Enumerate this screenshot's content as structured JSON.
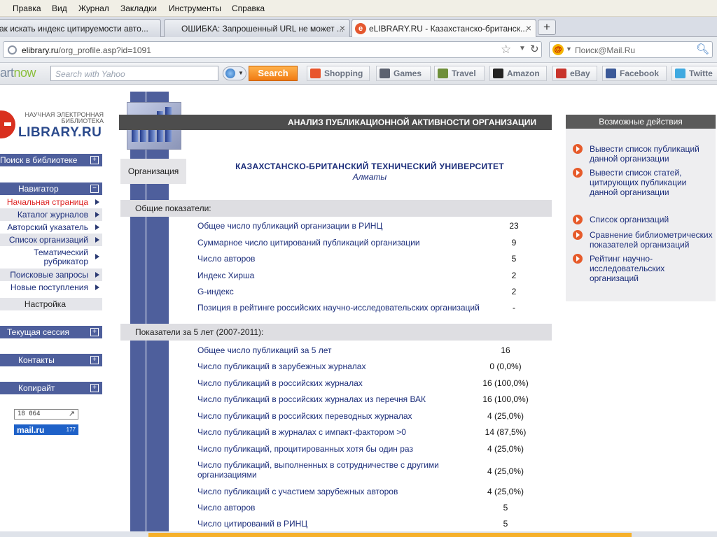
{
  "browser": {
    "menu": [
      "Правка",
      "Вид",
      "Журнал",
      "Закладки",
      "Инструменты",
      "Справка"
    ],
    "tabs": [
      {
        "title": "ак искать индекс цитируемости авто...",
        "active": false
      },
      {
        "title": "ОШИБКА: Запрошенный URL не может ...",
        "active": false
      },
      {
        "title": "eLIBRARY.RU - Казахстанско-британск...",
        "active": true,
        "favicon": "e"
      }
    ],
    "new_tab_label": "+",
    "close_glyph": "×",
    "url_host": "elibrary.ru",
    "url_path": "/org_profile.asp?id=1091",
    "search_placeholder": "Поиск@Mail.Ru",
    "search_engine_icon": "mailru-icon"
  },
  "toolbar": {
    "brand_prefix": "art",
    "brand_suffix": "now",
    "search_placeholder": "Search with Yahoo",
    "search_button": "Search",
    "links": [
      {
        "label": "Shopping",
        "icon": "shopping-icon",
        "color": "#e8552c"
      },
      {
        "label": "Games",
        "icon": "games-icon",
        "color": "#5c6270"
      },
      {
        "label": "Travel",
        "icon": "travel-icon",
        "color": "#6e8f3a"
      },
      {
        "label": "Amazon",
        "icon": "amazon-icon",
        "color": "#222222"
      },
      {
        "label": "eBay",
        "icon": "ebay-icon",
        "color": "#c8342c"
      },
      {
        "label": "Facebook",
        "icon": "facebook-icon",
        "color": "#3b5998"
      },
      {
        "label": "Twitte",
        "icon": "twitter-icon",
        "color": "#3fa9e0"
      }
    ]
  },
  "logo": {
    "line1": "НАУЧНАЯ ЭЛЕКТРОННАЯ",
    "line2": "БИБЛИОТЕКА",
    "name": "LIBRARY.RU"
  },
  "sidebar": {
    "search": "Поиск в библиотеке",
    "navigator": "Навигатор",
    "items": [
      {
        "label": "Начальная страница",
        "active": true
      },
      {
        "label": "Каталог журналов"
      },
      {
        "label": "Авторский указатель"
      },
      {
        "label": "Список организаций"
      },
      {
        "label": "Тематический рубрикатор"
      },
      {
        "label": "Поисковые запросы"
      },
      {
        "label": "Новые поступления"
      }
    ],
    "settings": "Настройка",
    "session": "Текущая сессия",
    "contacts": "Контакты",
    "copyright": "Копирайт",
    "counter_value": "18 064",
    "mail_counter_label": "mail.ru",
    "mail_counter_value": "177"
  },
  "main": {
    "title": "АНАЛИЗ ПУБЛИКАЦИОННОЙ АКТИВНОСТИ ОРГАНИЗАЦИИ",
    "org_label": "Организация",
    "org_name": "КАЗАХСТАНСКО-БРИТАНСКИЙ ТЕХНИЧЕСКИЙ УНИВЕРСИТЕТ",
    "org_city": "Алматы",
    "general_title": "Общие показатели:",
    "general": [
      {
        "label": "Общее число публикаций организации в РИНЦ",
        "value": "23"
      },
      {
        "label": "Суммарное число цитирований публикаций организации",
        "value": "9"
      },
      {
        "label": "Число авторов",
        "value": "5"
      },
      {
        "label": "Индекс Хирша",
        "value": "2"
      },
      {
        "label": "G-индекс",
        "value": "2"
      },
      {
        "label": "Позиция в рейтинге российских научно-исследовательских организаций",
        "value": "-"
      }
    ],
    "period_title": "Показатели за 5 лет (2007-2011):",
    "period": [
      {
        "label": "Общее число публикаций за 5 лет",
        "value": "16"
      },
      {
        "label": "Число публикаций в зарубежных журналах",
        "value": "0 (0,0%)"
      },
      {
        "label": "Число публикаций в российских журналах",
        "value": "16 (100,0%)"
      },
      {
        "label": "Число публикаций в российских журналах из перечня ВАК",
        "value": "16 (100,0%)"
      },
      {
        "label": "Число публикаций в российских переводных журналах",
        "value": "4 (25,0%)"
      },
      {
        "label": "Число публикаций в журналах с импакт-фактором >0",
        "value": "14 (87,5%)"
      },
      {
        "label": "Число публикаций, процитированных хотя бы один раз",
        "value": "4 (25,0%)"
      },
      {
        "label": "Число публикаций, выполненных в сотрудничестве с другими организациями",
        "value": "4 (25,0%)"
      },
      {
        "label": "Число публикаций с участием зарубежных авторов",
        "value": "4 (25,0%)"
      },
      {
        "label": "Число авторов",
        "value": "5"
      },
      {
        "label": "Число цитирований в РИНЦ",
        "value": "5"
      }
    ]
  },
  "actions": {
    "title": "Возможные действия",
    "items": [
      "Вывести список публикаций данной организации",
      "Вывести список статей, цитирующих публикации данной организации",
      "Список организаций",
      "Сравнение библиометрических показателей организаций",
      "Рейтинг научно-исследовательских организаций"
    ]
  }
}
